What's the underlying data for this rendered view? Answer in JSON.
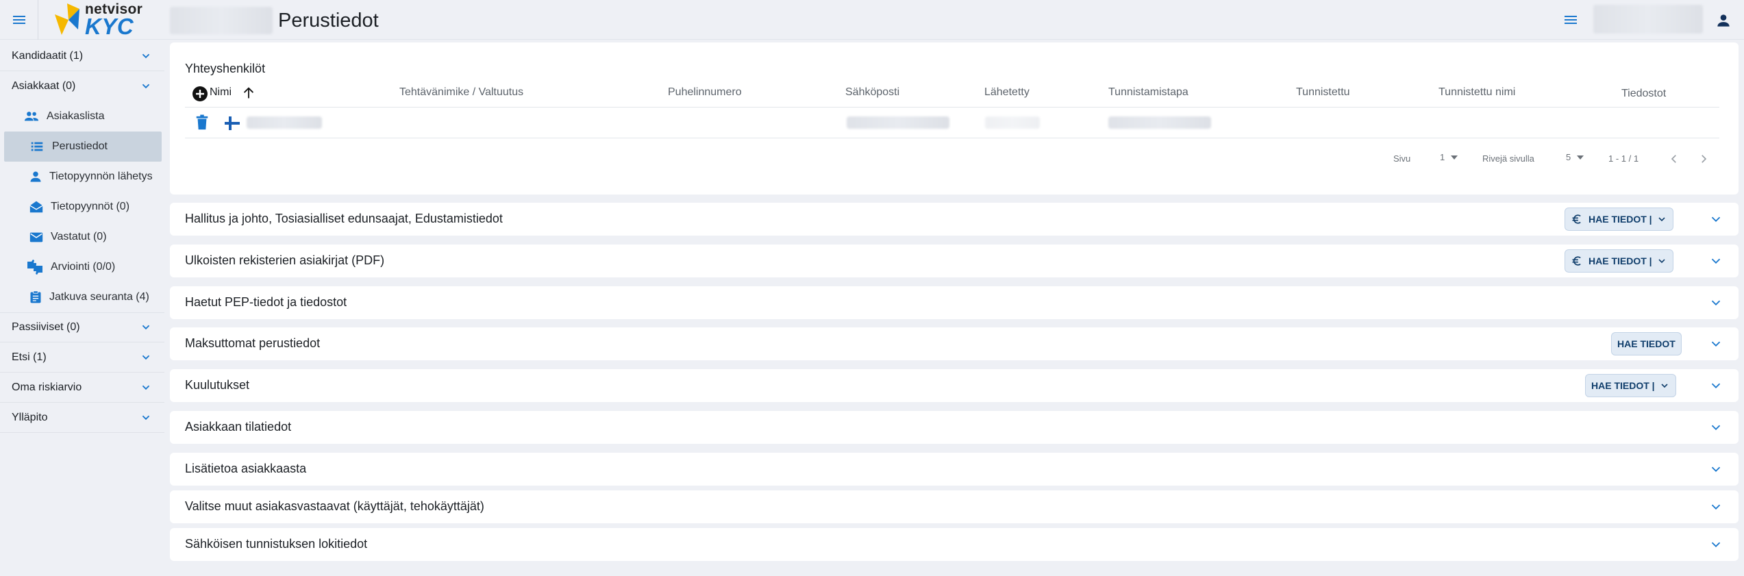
{
  "brand": {
    "top": "netvisor",
    "bottom": "KYC"
  },
  "header": {
    "title": "Perustiedot"
  },
  "sidebar": {
    "sections": [
      {
        "label": "Kandidaatit (1)"
      },
      {
        "label": "Asiakkaat (0)"
      }
    ],
    "items": [
      {
        "label": "Asiakaslista",
        "icon": "people-icon"
      },
      {
        "label": "Perustiedot",
        "icon": "list-icon"
      },
      {
        "label": "Tietopyynnön lähetys",
        "icon": "person-icon"
      },
      {
        "label": "Tietopyynnöt (0)",
        "icon": "drafts-icon"
      },
      {
        "label": "Vastatut (0)",
        "icon": "mail-icon"
      },
      {
        "label": "Arviointi (0/0)",
        "icon": "thumbs-icon"
      },
      {
        "label": "Jatkuva seuranta (4)",
        "icon": "assignment-icon"
      }
    ],
    "bottom_sections": [
      {
        "label": "Passiiviset (0)"
      },
      {
        "label": "Etsi (1)"
      },
      {
        "label": "Oma riskiarvio"
      },
      {
        "label": "Ylläpito"
      }
    ]
  },
  "contacts": {
    "title": "Yhteyshenkilöt",
    "columns": [
      "Nimi",
      "Tehtävänimike / Valtuutus",
      "Puhelinnumero",
      "Sähköposti",
      "Lähetetty",
      "Tunnistamistapa",
      "Tunnistettu",
      "Tunnistettu nimi",
      "Tiedostot"
    ],
    "pager": {
      "page_label": "Sivu",
      "page_value": "1",
      "rows_label": "Rivejä sivulla",
      "rows_value": "5",
      "range": "1 - 1 / 1"
    }
  },
  "panels": [
    {
      "title": "Hallitus ja johto, Tosiasialliset edunsaajat, Edustamistiedot",
      "button": "HAE TIEDOT |"
    },
    {
      "title": "Ulkoisten rekisterien asiakirjat (PDF)",
      "button": "HAE TIEDOT |"
    },
    {
      "title": "Haetut PEP-tiedot ja tiedostot"
    },
    {
      "title": "Maksuttomat perustiedot",
      "button": "HAE TIEDOT"
    },
    {
      "title": "Kuulutukset",
      "button": "HAE TIEDOT |"
    },
    {
      "title": "Asiakkaan tilatiedot"
    },
    {
      "title": "Lisätietoa asiakkaasta"
    },
    {
      "title": "Valitse muut asiakasvastaavat (käyttäjät, tehokäyttäjät)"
    },
    {
      "title": "Sähköisen tunnistuksen lokitiedot"
    }
  ],
  "colors": {
    "accent": "#1a78ce",
    "sidebar_active": "#c9d3de",
    "button_bg": "#e2ebf5",
    "background": "#eef0f5"
  }
}
